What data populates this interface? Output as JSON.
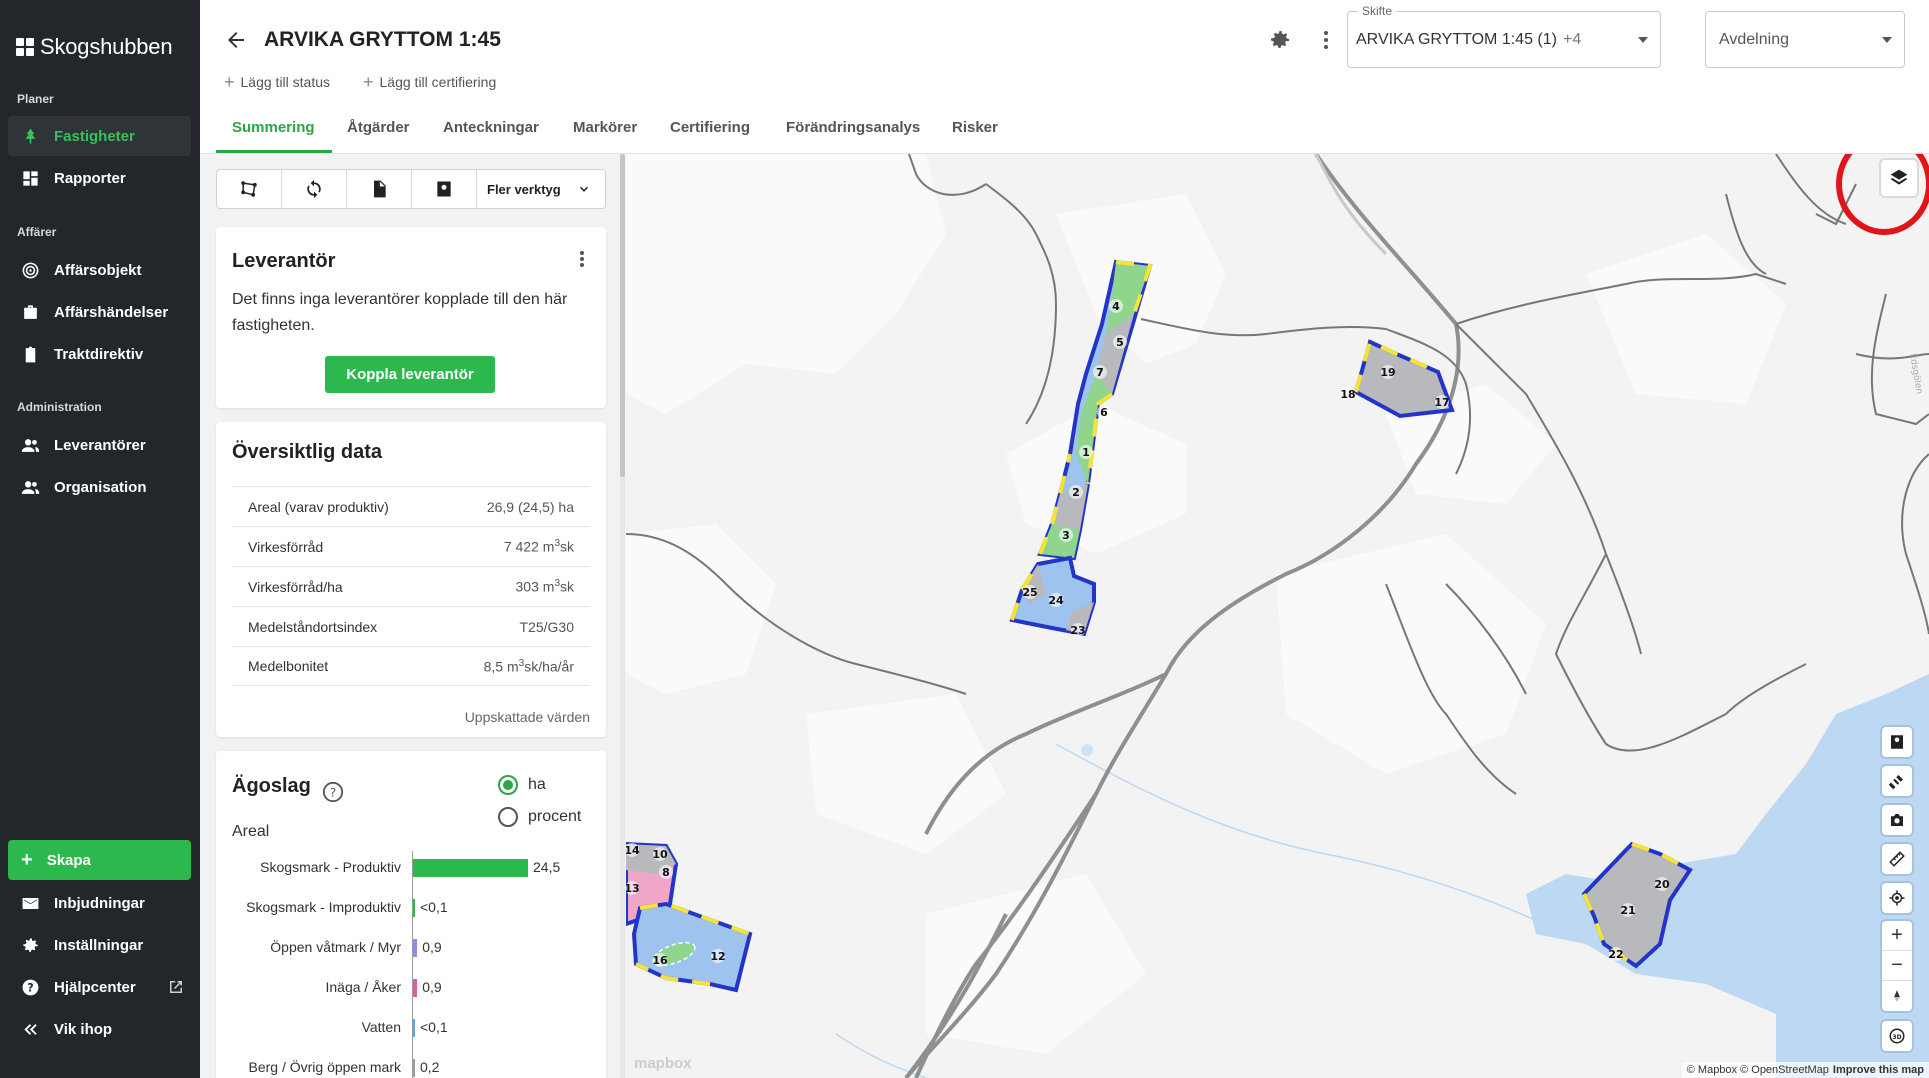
{
  "app": {
    "brand": "Skogshubben"
  },
  "sidebar": {
    "sections": {
      "planer": "Planer",
      "affarer": "Affärer",
      "administration": "Administration"
    },
    "items": [
      {
        "label": "Fastigheter",
        "icon": "tree-icon",
        "active": true
      },
      {
        "label": "Rapporter",
        "icon": "dashboard-icon"
      },
      {
        "label": "Affärsobjekt",
        "icon": "target-icon"
      },
      {
        "label": "Affärshändelser",
        "icon": "briefcase-icon"
      },
      {
        "label": "Traktdirektiv",
        "icon": "clipboard-icon"
      },
      {
        "label": "Leverantörer",
        "icon": "people-icon"
      },
      {
        "label": "Organisation",
        "icon": "people-icon"
      }
    ],
    "create": "Skapa",
    "bottom": [
      {
        "label": "Inbjudningar",
        "icon": "mail-icon"
      },
      {
        "label": "Inställningar",
        "icon": "gear-icon"
      },
      {
        "label": "Hjälpcenter",
        "icon": "help-icon"
      },
      {
        "label": "Vik ihop",
        "icon": "collapse-icon"
      }
    ]
  },
  "header": {
    "title": "ARVIKA GRYTTOM 1:45",
    "add_status": "Lägg till status",
    "add_cert": "Lägg till certifiering",
    "skifte_label": "Skifte",
    "skifte_value": "ARVIKA GRYTTOM 1:45 (1)",
    "skifte_extra": "+4",
    "avdelning_placeholder": "Avdelning",
    "tabs": [
      "Summering",
      "Åtgärder",
      "Anteckningar",
      "Markörer",
      "Certifiering",
      "Förändringsanalys",
      "Risker"
    ]
  },
  "toolbar": {
    "more": "Fler verktyg"
  },
  "leverantor": {
    "title": "Leverantör",
    "text": "Det finns inga leverantörer kopplade till den här fastigheten.",
    "button": "Koppla leverantör"
  },
  "overview": {
    "title": "Översiktlig data",
    "rows": [
      {
        "label": "Areal (varav produktiv)",
        "value": "26,9 (24,5) ha"
      },
      {
        "label": "Virkesförråd",
        "value": "7 422 m",
        "sup": "3",
        "unit": "sk"
      },
      {
        "label": "Virkesförråd/ha",
        "value": "303 m",
        "sup": "3",
        "unit": "sk"
      },
      {
        "label": "Medelståndortsindex",
        "value": "T25/G30"
      },
      {
        "label": "Medelbonitet",
        "value": "8,5 m",
        "sup": "3",
        "unit": "sk/ha/år"
      }
    ],
    "estimated": "Uppskattade värden"
  },
  "agoslag": {
    "title": "Ägoslag",
    "subtitle": "Areal",
    "radio_ha": "ha",
    "radio_procent": "procent",
    "chart_data": {
      "type": "bar",
      "categories": [
        "Skogsmark - Produktiv",
        "Skogsmark - Improduktiv",
        "Öppen våtmark / Myr",
        "Inäga / Åker",
        "Vatten",
        "Berg / Övrig öppen mark"
      ],
      "values": [
        24.5,
        0.05,
        0.9,
        0.9,
        0.05,
        0.2
      ],
      "labels": [
        "24,5",
        "<0,1",
        "0,9",
        "0,9",
        "<0,1",
        "0,2"
      ],
      "colors": [
        "#2db84d",
        "#2db84d",
        "#8e8cf0",
        "#e35ba0",
        "#5aa9e6",
        "#9aa0a6"
      ],
      "xlim": [
        0,
        24.5
      ]
    }
  },
  "map": {
    "attribution": "© Mapbox © OpenStreetMap",
    "improve": "Improve this map",
    "logo": "mapbox",
    "stand_numbers": [
      "4",
      "5",
      "7",
      "6",
      "1",
      "2",
      "3",
      "25",
      "24",
      "23",
      "19",
      "18",
      "17",
      "21",
      "20",
      "22",
      "14",
      "10",
      "8",
      "13",
      "16",
      "12"
    ]
  }
}
